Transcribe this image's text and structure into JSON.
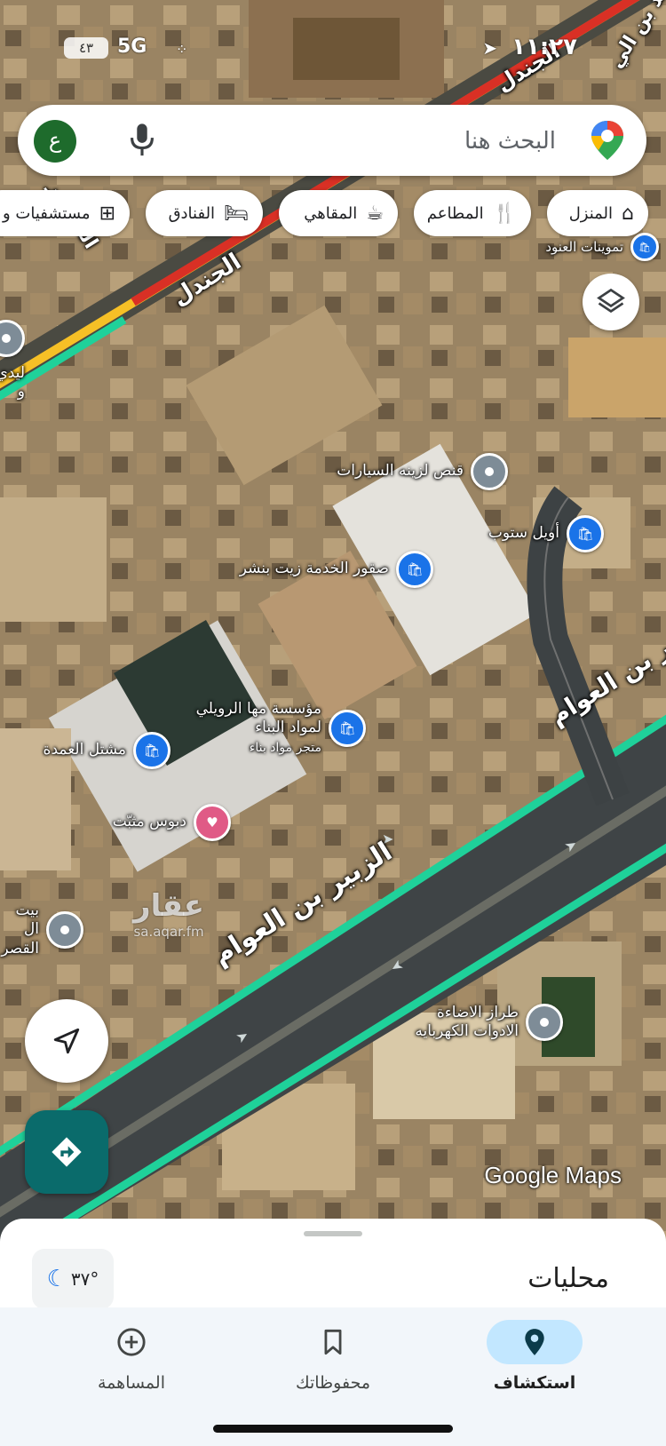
{
  "status_bar": {
    "time": "١١:٢٧",
    "network": "5G",
    "battery": "٤٣"
  },
  "search": {
    "placeholder": "البحث هنا",
    "avatar_letter": "ع"
  },
  "chips": [
    {
      "label": "المنزل",
      "icon": "home-icon"
    },
    {
      "label": "المطاعم",
      "icon": "restaurant-icon"
    },
    {
      "label": "المقاهي",
      "icon": "coffee-icon"
    },
    {
      "label": "الفنادق",
      "icon": "hotel-icon"
    },
    {
      "label": "مستشفيات و",
      "icon": "hospital-icon"
    }
  ],
  "streets": {
    "zubair_1": "الزبير بن العوام",
    "zubair_2": "الزبير بن العوام",
    "zubair_3": "بير بن العوام",
    "jandal_1": "الجندل",
    "jandal_2": "الجندل",
    "saad": "سعد بن الي",
    "muntasir": "المنتصر"
  },
  "pois": [
    {
      "id": "qanas",
      "name": "قنص لزينه السيارات",
      "type": "grey"
    },
    {
      "id": "oil-stop",
      "name": "أويل ستوب",
      "type": "blue"
    },
    {
      "id": "suqoor",
      "name": "صقور الخدمة زيت بنشر",
      "type": "blue"
    },
    {
      "id": "maha",
      "name": "مؤسسة مها الرويلي",
      "line2": "لمواد البناء",
      "sub": "متجر مواد بناء",
      "type": "blue"
    },
    {
      "id": "mashtal",
      "name": "مشتل العمدة",
      "type": "blue"
    },
    {
      "id": "dabbous",
      "name": "دبوس مثبّت",
      "type": "pink"
    },
    {
      "id": "tiraz",
      "name": "طراز الاضاءة",
      "line2": "الادوات الكهربايه",
      "type": "grey"
    },
    {
      "id": "bait",
      "name": "بيت ال",
      "line2": "القصر",
      "type": "grey"
    },
    {
      "id": "lady",
      "name": "ليدي و",
      "type": "grey"
    },
    {
      "id": "tamweenat",
      "name": "تموينات العنود",
      "type": "blue"
    }
  ],
  "watermark": {
    "main": "عقار",
    "url": "sa.aqar.fm"
  },
  "google_maps_logo": "Google Maps",
  "sheet": {
    "title": "محليات",
    "temperature": "٣٧°"
  },
  "nav": [
    {
      "label": "استكشاف",
      "icon": "explore-pin-icon",
      "active": true
    },
    {
      "label": "محفوظاتك",
      "icon": "bookmark-icon",
      "active": false
    },
    {
      "label": "المساهمة",
      "icon": "add-circle-icon",
      "active": false
    }
  ],
  "colors": {
    "road_green": "#1fd19a",
    "road_red": "#d93025",
    "road_yellow": "#f6c026",
    "accent_blue": "#1a73e8",
    "teal": "#0a6b6b"
  }
}
